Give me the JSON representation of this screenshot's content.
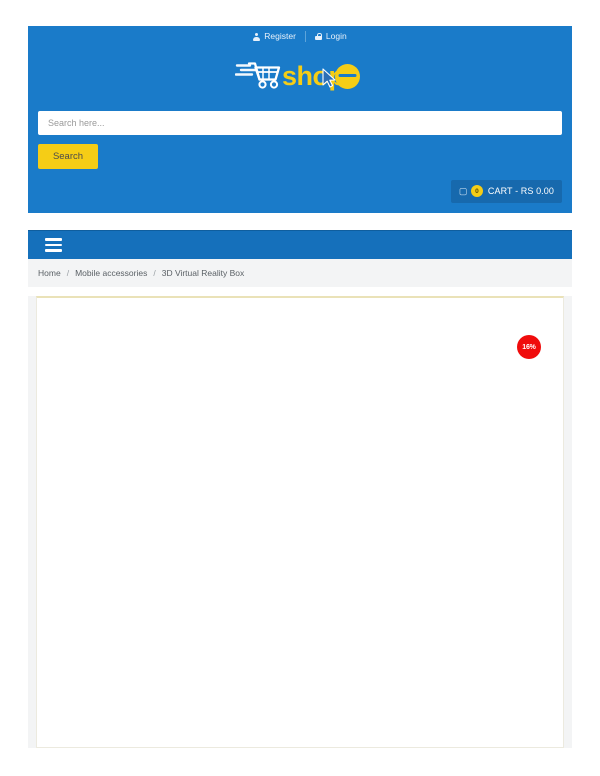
{
  "topbar": {
    "register_label": "Register",
    "login_label": "Login",
    "register_icon": "user-icon",
    "login_icon": "lock-icon"
  },
  "brand": {
    "name": "shope",
    "logo_icon": "shopping-cart-icon",
    "cart_color": "#ffffff",
    "text_color": "#f5cd16",
    "cursor_color": "#2b6fb5"
  },
  "search": {
    "placeholder": "Search here...",
    "value": "",
    "button_label": "Search",
    "button_color": "#f5cd16"
  },
  "cart": {
    "icon": "cart-icon",
    "count": "0",
    "label": "CART - RS 0.00",
    "badge_color": "#f5cd16"
  },
  "nav": {
    "menu_icon": "hamburger-menu-icon"
  },
  "breadcrumb": {
    "items": [
      {
        "label": "Home",
        "current": false
      },
      {
        "label": "Mobile accessories",
        "current": false
      },
      {
        "label": "3D Virtual Reality Box",
        "current": true
      }
    ],
    "separator": "/"
  },
  "product": {
    "discount_badge": "16%",
    "badge_color": "#f00c0c"
  },
  "theme": {
    "header_blue": "#1a7bc9",
    "nav_blue": "#1570bb",
    "cart_blue": "#1769ad",
    "page_gray": "#f3f4f5",
    "accent_yellow": "#f5cd16"
  }
}
